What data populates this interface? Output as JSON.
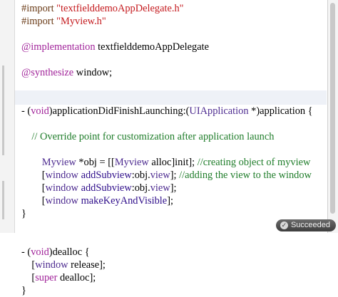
{
  "status": {
    "text": "Succeeded",
    "icon": "check-circle-icon"
  },
  "colors": {
    "keyword": "#a1249a",
    "preprocessor": "#6b3c18",
    "string": "#c4191d",
    "class": "#4d2b90",
    "method": "#2e0d8a",
    "comment": "#1f7d2a",
    "current_line": "#eef1f7"
  },
  "code_lines": [
    [
      {
        "t": "#import ",
        "c": "pre"
      },
      {
        "t": "\"textfielddemoAppDelegate.h\"",
        "c": "str"
      }
    ],
    [
      {
        "t": "#import ",
        "c": "pre"
      },
      {
        "t": "\"Myview.h\"",
        "c": "str"
      }
    ],
    [],
    [
      {
        "t": "@implementation",
        "c": "kw"
      },
      {
        "t": " textfielddemoAppDelegate",
        "c": ""
      }
    ],
    [],
    [
      {
        "t": "@synthesize",
        "c": "kw"
      },
      {
        "t": " window;",
        "c": ""
      }
    ],
    [],
    [],
    [
      {
        "t": "- (",
        "c": ""
      },
      {
        "t": "void",
        "c": "kw"
      },
      {
        "t": ")applicationDidFinishLaunching:(",
        "c": ""
      },
      {
        "t": "UIApplication",
        "c": "cls"
      },
      {
        "t": " *)application {",
        "c": ""
      }
    ],
    [],
    [
      {
        "t": "    ",
        "c": ""
      },
      {
        "t": "// Override point for customization after application launch",
        "c": "cmt"
      }
    ],
    [],
    [
      {
        "t": "        ",
        "c": ""
      },
      {
        "t": "Myview",
        "c": "cls"
      },
      {
        "t": " *obj = [[",
        "c": ""
      },
      {
        "t": "Myview",
        "c": "cls"
      },
      {
        "t": " alloc]init]; ",
        "c": ""
      },
      {
        "t": "//creating object of myview",
        "c": "cmt"
      }
    ],
    [
      {
        "t": "        [",
        "c": ""
      },
      {
        "t": "window",
        "c": "cls"
      },
      {
        "t": " ",
        "c": ""
      },
      {
        "t": "addSubview",
        "c": "fn"
      },
      {
        "t": ":obj.",
        "c": ""
      },
      {
        "t": "view",
        "c": "cls"
      },
      {
        "t": "]; ",
        "c": ""
      },
      {
        "t": "//adding the view to the window",
        "c": "cmt"
      }
    ],
    [
      {
        "t": "        [",
        "c": ""
      },
      {
        "t": "window",
        "c": "cls"
      },
      {
        "t": " ",
        "c": ""
      },
      {
        "t": "addSubview",
        "c": "fn"
      },
      {
        "t": ":obj.",
        "c": ""
      },
      {
        "t": "view",
        "c": "cls"
      },
      {
        "t": "];",
        "c": ""
      }
    ],
    [
      {
        "t": "        [",
        "c": ""
      },
      {
        "t": "window",
        "c": "cls"
      },
      {
        "t": " ",
        "c": ""
      },
      {
        "t": "makeKeyAndVisible",
        "c": "fn"
      },
      {
        "t": "];",
        "c": ""
      }
    ],
    [
      {
        "t": "}",
        "c": ""
      }
    ],
    [],
    [],
    [
      {
        "t": "- (",
        "c": ""
      },
      {
        "t": "void",
        "c": "kw"
      },
      {
        "t": ")dealloc {",
        "c": ""
      }
    ],
    [
      {
        "t": "    [",
        "c": ""
      },
      {
        "t": "window",
        "c": "cls"
      },
      {
        "t": " release];",
        "c": ""
      }
    ],
    [
      {
        "t": "    [",
        "c": ""
      },
      {
        "t": "super",
        "c": "kw"
      },
      {
        "t": " dealloc];",
        "c": ""
      }
    ],
    [
      {
        "t": "}",
        "c": ""
      }
    ]
  ]
}
